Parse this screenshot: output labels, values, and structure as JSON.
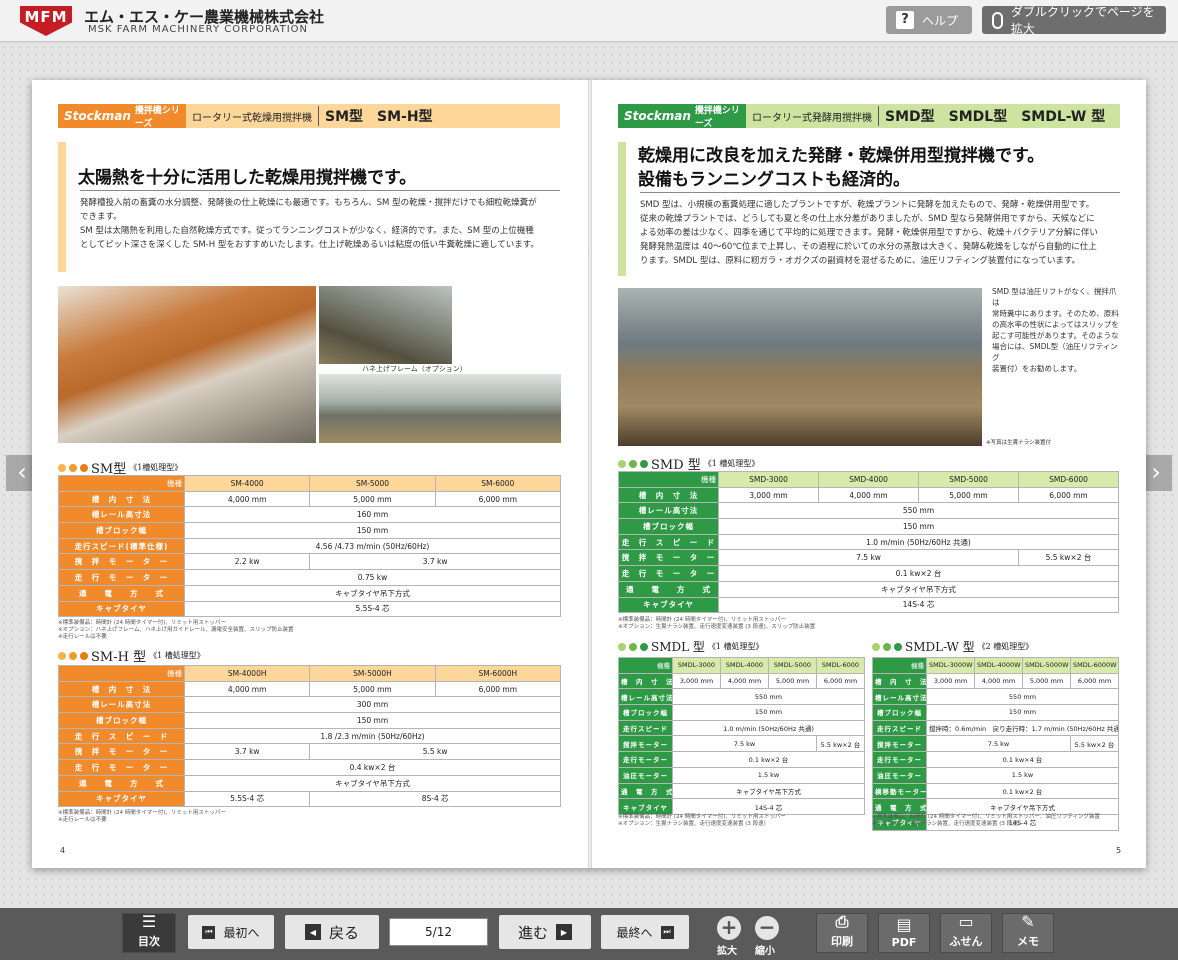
{
  "header": {
    "logo": "MFM",
    "company_jp": "エム・エス・ケー農業機械株式会社",
    "company_en": "MSK FARM MACHINERY CORPORATION",
    "help": "ヘルプ",
    "zoom": "ダブルクリックでページを拡大"
  },
  "left": {
    "series": "攪拌機シリーズ",
    "brand": "Stockman",
    "category": "ロータリー式乾燥用撹拌機",
    "models": "SM型　SM-H型",
    "headline": "太陽熱を十分に活用した乾燥用撹拌機です。",
    "body": [
      "発酵槽投入前の畜糞の水分調整、発酵後の仕上乾燥にも最適です。もちろん、SM 型の乾燥・撹拌だけでも細粒乾燥糞が",
      "できます。",
      "SM 型は太陽熱を利用した自然乾燥方式です。従ってランニングコストが少なく、経済的です。また、SM 型の上位機種",
      "としてピット深さを深くした SM-H 型をおすすめいたします。仕上げ乾燥あるいは粘度の低い牛糞乾燥に適しています。"
    ],
    "photo_caption": "ハネ上げフレーム（オプション）",
    "sm": {
      "title": "SM型",
      "sub": "《1槽処理型》",
      "head": [
        "機種",
        "SM-4000",
        "SM-5000",
        "SM-6000"
      ],
      "rows": [
        [
          "槽　内　寸　法",
          "4,000 mm",
          "5,000 mm",
          "6,000 mm"
        ],
        [
          "槽レール高寸法",
          "160 mm"
        ],
        [
          "槽ブロック幅",
          "150 mm"
        ],
        [
          "走行スピード(標準仕様)",
          "4.56 /4.73 m/min (50Hz/60Hz)"
        ],
        [
          "撹　拌　モ　ー　タ　ー",
          "2.2 kw",
          "3.7 kw"
        ],
        [
          "走　行　モ　ー　タ　ー",
          "0.75 kw"
        ],
        [
          "通　　電　　方　　式",
          "キャブタイヤ吊下方式"
        ],
        [
          "キャブタイヤ",
          "5.5S-4 芯"
        ]
      ],
      "notes": [
        "※標準装備品：時間計 (24 時間タイマー付)、リミット用ストッパー",
        "※オプション：ハネ上げフレーム、ハネ上げ用ガイドレール、漏電安全装置、スリップ防止装置",
        "※走行レールは不要"
      ]
    },
    "smh": {
      "title": "SM-H 型",
      "sub": "《1 槽処理型》",
      "head": [
        "機種",
        "SM-4000H",
        "SM-5000H",
        "SM-6000H"
      ],
      "rows": [
        [
          "槽　内　寸　法",
          "4,000 mm",
          "5,000 mm",
          "6,000 mm"
        ],
        [
          "槽レール高寸法",
          "300 mm"
        ],
        [
          "槽ブロック幅",
          "150 mm"
        ],
        [
          "走　行　ス　ピ　ー　ド",
          "1.8 /2.3 m/min (50Hz/60Hz)"
        ],
        [
          "撹　拌　モ　ー　タ　ー",
          "3.7 kw",
          "5.5 kw"
        ],
        [
          "走　行　モ　ー　タ　ー",
          "0.4 kw×2 台"
        ],
        [
          "通　　電　　方　　式",
          "キャブタイヤ吊下方式"
        ],
        [
          "キャブタイヤ",
          "5.5S-4 芯",
          "8S-4 芯"
        ]
      ],
      "notes": [
        "※標準装備品：時間計 (24 時間タイマー付)、リミット用ストッパー",
        "※走行レールは不要"
      ]
    },
    "page_no": "4"
  },
  "right": {
    "series": "攪拌機シリーズ",
    "brand": "Stockman",
    "category": "ロータリー式発酵用撹拌機",
    "models": "SMD型　SMDL型　SMDL-W 型",
    "headline1": "乾燥用に改良を加えた発酵・乾燥併用型撹拌機です。",
    "headline2": "設備もランニングコストも経済的。",
    "body": [
      "SMD 型は、小規模の畜糞処理に適したプラントですが、乾燥プラントに発酵を加えたもので、発酵・乾燥併用型です。",
      "従来の乾燥プラントでは、どうしても夏と冬の仕上水分差がありましたが、SMD 型なら発酵併用ですから、天候などに",
      "よる効率の差は少なく、四季を通じて平均的に処理できます。発酵・乾燥併用型ですから、乾燥＋バクテリア分解に伴い",
      "発酵発熱温度は 40〜60℃位まで上昇し、その過程に於いての水分の蒸散は大きく、発酵&乾燥をしながら自動的に仕上",
      "ります。SMDL 型は、原料に籾ガラ・オガクズの副資材を混ぜるために、油圧リフティング装置付になっています。"
    ],
    "side": [
      "SMD 型は油圧リフトがなく、撹拌爪は",
      "常時糞中にあります。そのため、原料",
      "の高水率の性状によってはスリップを",
      "起こす可能性があります。そのような",
      "場合には、SMDL型（油圧リフティング",
      "装置付）をお勧めします。"
    ],
    "photo_caption": "※写真は生糞ナラシ装置付",
    "smd": {
      "title": "SMD 型",
      "sub": "《1 槽処理型》",
      "head": [
        "機種",
        "SMD-3000",
        "SMD-4000",
        "SMD-5000",
        "SMD-6000"
      ],
      "rows": [
        [
          "槽　内　寸　法",
          "3,000 mm",
          "4,000 mm",
          "5,000 mm",
          "6,000 mm"
        ],
        [
          "槽レール高寸法",
          "550 mm"
        ],
        [
          "槽ブロック幅",
          "150 mm"
        ],
        [
          "走　行　ス　ピ　ー　ド",
          "1.0 m/min (50Hz/60Hz 共通)"
        ],
        [
          "撹　拌　モ　ー　タ　ー",
          "7.5 kw",
          "5.5 kw×2 台"
        ],
        [
          "走　行　モ　ー　タ　ー",
          "0.1 kw×2 台"
        ],
        [
          "通　　電　　方　　式",
          "キャブタイヤ吊下方式"
        ],
        [
          "キャブタイヤ",
          "14S-4 芯"
        ]
      ],
      "notes": [
        "※標準装備品：時間計 (24 時間タイマー付)、リミット用ストッパー",
        "※オプション：生糞ナラシ装置、走行速度変速装置 (3 段速)、スリップ防止装置"
      ]
    },
    "smdl": {
      "title": "SMDL 型",
      "sub": "《1 槽処理型》",
      "head": [
        "機種",
        "SMDL-3000",
        "SMDL-4000",
        "SMDL-5000",
        "SMDL-6000"
      ],
      "rows": [
        [
          "槽　内　寸　法",
          "3,000 mm",
          "4,000 mm",
          "5,000 mm",
          "6,000 mm"
        ],
        [
          "槽レール高寸法",
          "550 mm"
        ],
        [
          "槽ブロック幅",
          "150 mm"
        ],
        [
          "走行スピード",
          "1.0 m/min (50Hz/60Hz 共通)"
        ],
        [
          "撹拌モーター",
          "7.5 kw",
          "5.5 kw×2 台"
        ],
        [
          "走行モーター",
          "0.1 kw×2 台"
        ],
        [
          "油圧モーター",
          "1.5 kw"
        ],
        [
          "通　電　方　式",
          "キャブタイヤ吊下方式"
        ],
        [
          "キャブタイヤ",
          "14S-4 芯"
        ]
      ],
      "notes": [
        "※標準装備品：時間計 (24 時間タイマー付)、リミット用ストッパー",
        "※オプション：生糞ナラシ装置、走行速度変速装置 (3 段速)"
      ]
    },
    "smdlw": {
      "title": "SMDL-W 型",
      "sub": "《2 槽処理型》",
      "head": [
        "機種",
        "SMDL-3000W",
        "SMDL-4000W",
        "SMDL-5000W",
        "SMDL-6000W"
      ],
      "rows": [
        [
          "槽　内　寸　法",
          "3,000 mm",
          "4,000 mm",
          "5,000 mm",
          "6,000 mm"
        ],
        [
          "槽レール高寸法",
          "550 mm"
        ],
        [
          "槽ブロック幅",
          "150 mm"
        ],
        [
          "走行スピード",
          "撹拌時：0.6m/min　戻り走行時：1.7 m/min (50Hz/60Hz 共通)"
        ],
        [
          "撹拌モーター",
          "7.5 kw",
          "5.5 kw×2 台"
        ],
        [
          "走行モーター",
          "0.1 kw×4 台"
        ],
        [
          "油圧モーター",
          "1.5 kw"
        ],
        [
          "横移動モーター",
          "0.1 kw×2 台"
        ],
        [
          "通　電　方　式",
          "キャブタイヤ吊下方式"
        ],
        [
          "キャブタイヤ",
          "14S-4 芯"
        ]
      ],
      "notes": [
        "※標準装備品：時間計 (24 時間タイマー付)、リミット用ストッパー、油圧リフティング装置",
        "※オプション：生糞ナラシ装置、走行速度変速装置 (3 段速)"
      ]
    },
    "page_no": "5"
  },
  "toolbar": {
    "toc": "目次",
    "first": "最初へ",
    "back": "戻る",
    "page": "5/12",
    "next": "進む",
    "last": "最終へ",
    "zoom_in": "拡大",
    "zoom_out": "縮小",
    "print": "印刷",
    "pdf": "PDF",
    "sticky": "ふせん",
    "memo": "メモ"
  },
  "colors": {
    "orange": "#f18a2a",
    "orange_light": "#fdd69a",
    "green": "#2f9a46",
    "green_light": "#d6eba9",
    "header_lime": "#cde3a0"
  }
}
